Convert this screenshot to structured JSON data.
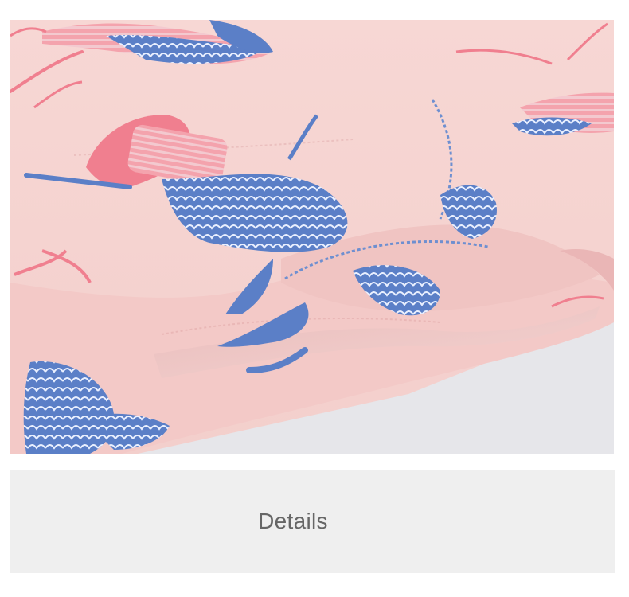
{
  "caption": {
    "label": "Details"
  },
  "colors": {
    "fabric_pink": "#f6d8d6",
    "print_blue": "#5b7fc7",
    "print_coral": "#f07f8f",
    "caption_background": "#efefef",
    "caption_text": "#666666"
  }
}
